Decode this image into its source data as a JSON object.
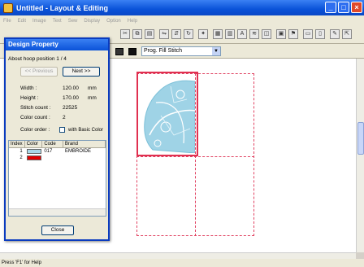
{
  "window": {
    "title": "Untitled - Layout & Editing"
  },
  "menu": [
    "File",
    "Edit",
    "Image",
    "Text",
    "Sew",
    "Display",
    "Option",
    "Help"
  ],
  "toolbar": {
    "fill_select": "Prog. Fill Stitch",
    "fill_arrow": "▼"
  },
  "dialog": {
    "title": "Design Property",
    "hoop_position": "About hoop position 1 / 4",
    "prev_button": "<< Previous",
    "next_button": "Next >>",
    "width_label": "Width :",
    "width_value": "120.00",
    "width_unit": "mm",
    "height_label": "Height :",
    "height_value": "170.00",
    "height_unit": "mm",
    "stitch_label": "Stitch count :",
    "stitch_value": "22525",
    "color_count_label": "Color count :",
    "color_count_value": "2",
    "color_order_label": "Color order :",
    "basic_color_label": "with Basic Color",
    "table": {
      "headers": [
        "Index",
        "Color",
        "Code",
        "Brand"
      ],
      "rows": [
        {
          "index": "1",
          "color": "#a8d8e8",
          "code": "017",
          "brand": "EMBROIDE"
        },
        {
          "index": "2",
          "color": "#e00000",
          "code": "",
          "brand": ""
        }
      ]
    },
    "close_button": "Close"
  },
  "status": {
    "text": "Press 'F1' for Help"
  },
  "colors": {
    "lace": "#9fd3e6",
    "hoop": "#e03050"
  }
}
